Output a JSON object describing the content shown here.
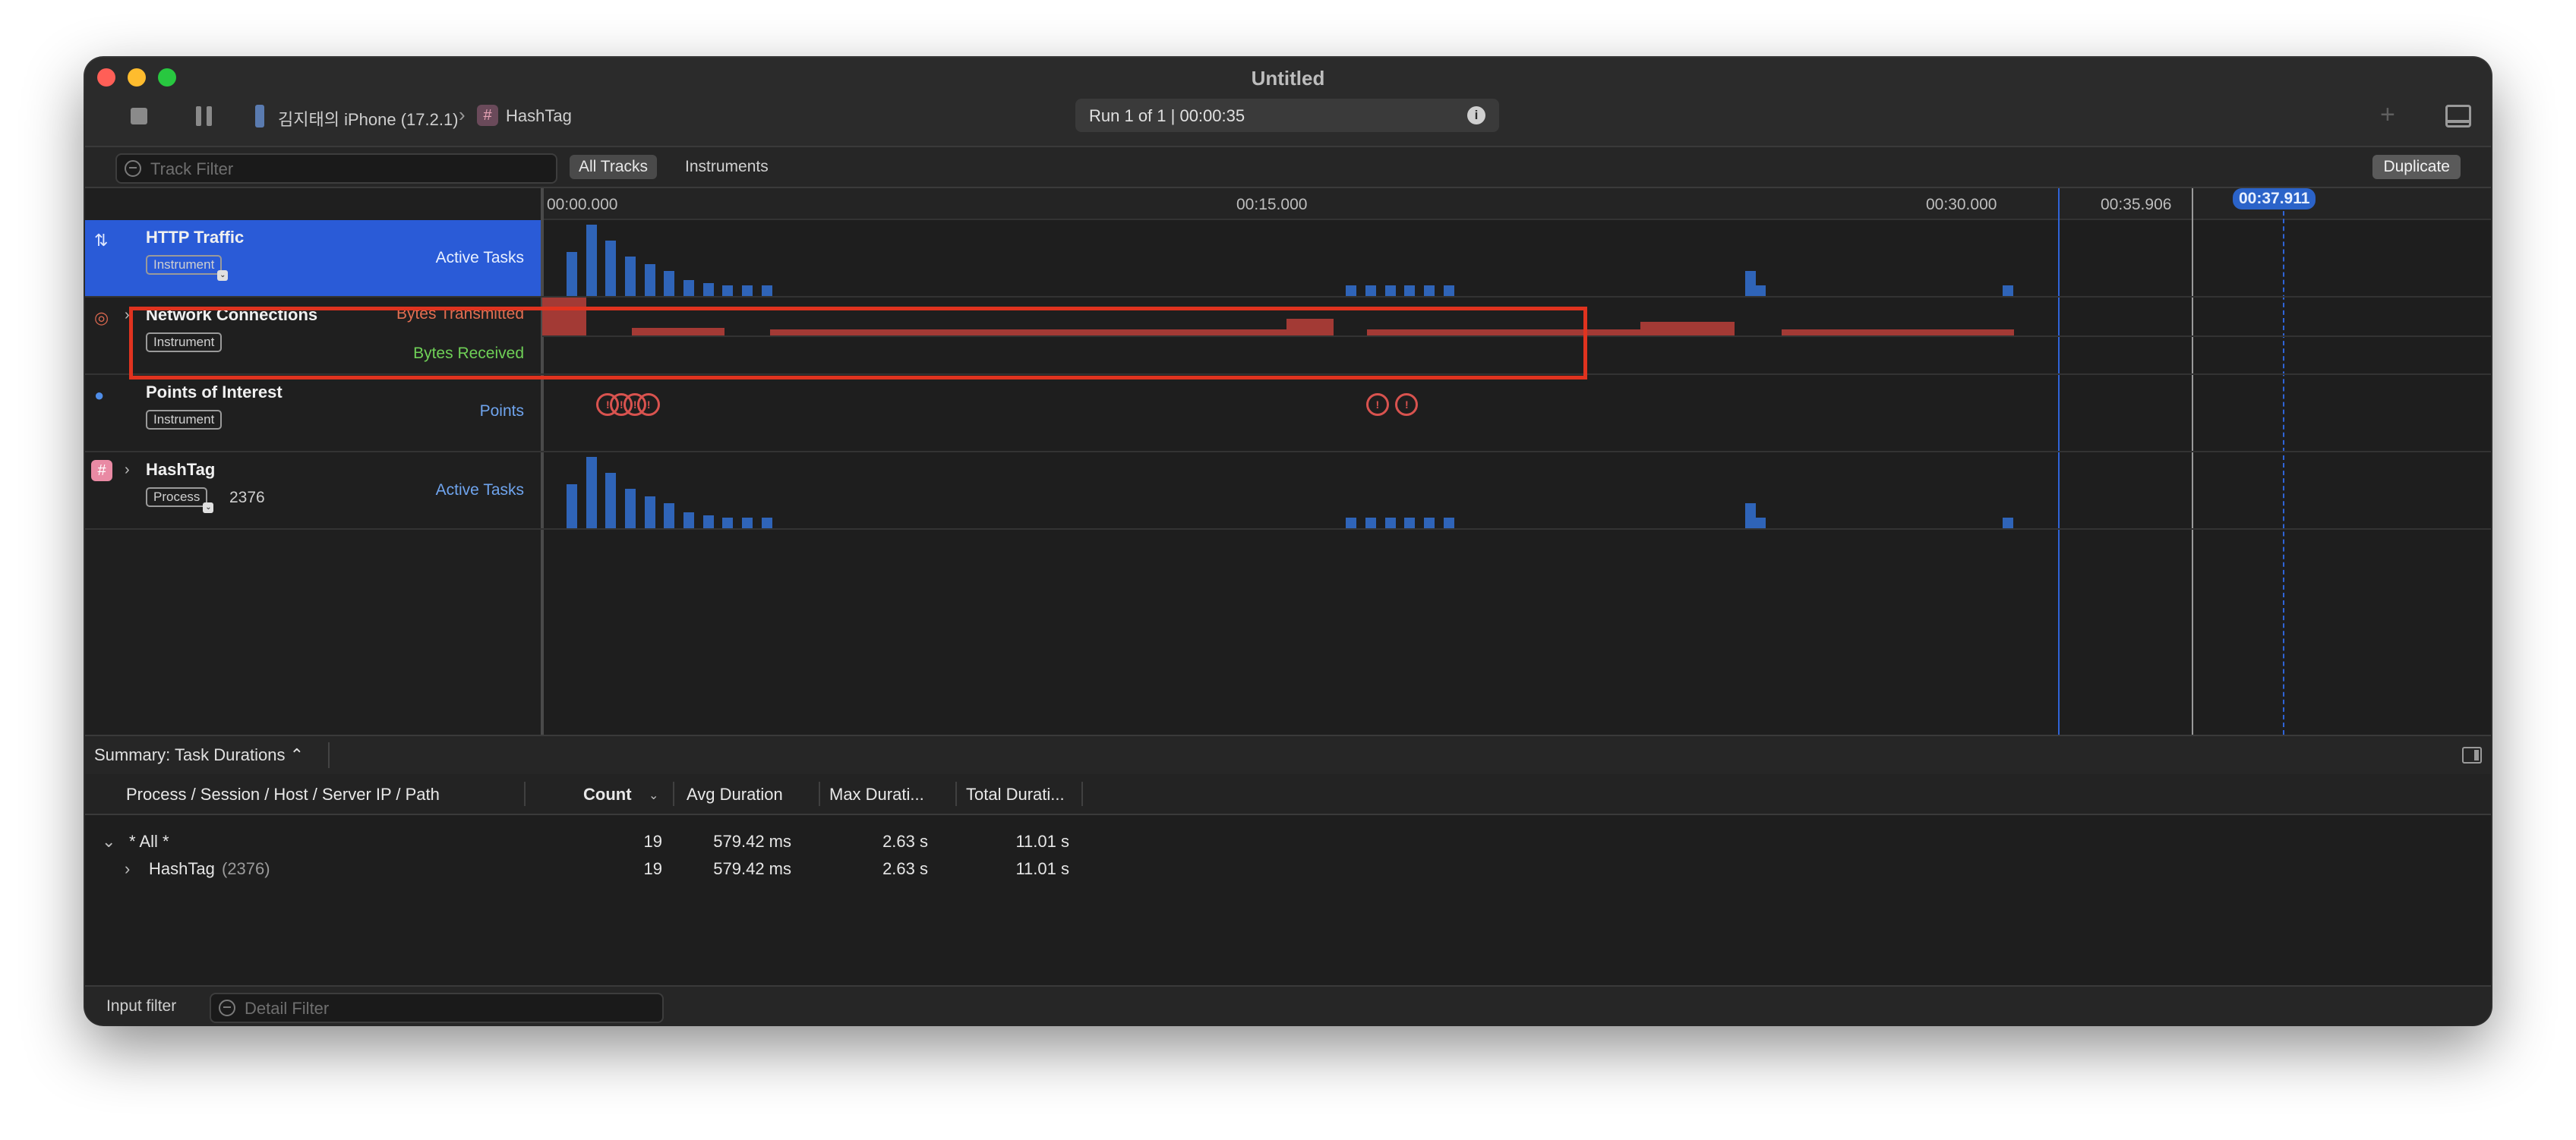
{
  "window": {
    "title": "Untitled"
  },
  "toolbar": {
    "device": "김지태의 iPhone (17.2.1)",
    "app": "HashTag",
    "app_icon_glyph": "#",
    "run_status": "Run 1 of 1  |  00:00:35",
    "info_glyph": "i",
    "plus_glyph": "+"
  },
  "filterbar": {
    "track_filter_placeholder": "Track Filter",
    "all_tracks": "All Tracks",
    "instruments": "Instruments",
    "duplicate": "Duplicate"
  },
  "ruler": {
    "ticks": [
      "00:00.000",
      "00:15.000",
      "00:30.000",
      "00:35.906"
    ],
    "cursor": "00:37.911"
  },
  "tracks": [
    {
      "title": "HTTP Traffic",
      "badge": "Instrument",
      "right": "Active Tasks",
      "icon": "⇅"
    },
    {
      "title": "Network Connections",
      "badge": "Instrument",
      "right_top": "Bytes Transmitted",
      "right_bottom": "Bytes Received",
      "icon": "◎",
      "caret": "›"
    },
    {
      "title": "Points of Interest",
      "badge": "Instrument",
      "right": "Points",
      "icon": "●"
    },
    {
      "title": "HashTag",
      "badge": "Process",
      "pid": "2376",
      "right": "Active Tasks",
      "icon": "#",
      "caret": "›"
    }
  ],
  "summary": {
    "label": "Summary: Task Durations ⌃"
  },
  "table": {
    "headers": [
      "Process / Session / Host / Server IP / Path",
      "Count",
      "Avg Duration",
      "Max Durati...",
      "Total Durati..."
    ],
    "rows": [
      {
        "name": "* All *",
        "caret": "⌄",
        "count": "19",
        "avg": "579.42 ms",
        "max": "2.63 s",
        "total": "11.01 s"
      },
      {
        "name": "HashTag",
        "pid": "(2376)",
        "caret": "›",
        "count": "19",
        "avg": "579.42 ms",
        "max": "2.63 s",
        "total": "11.01 s"
      }
    ]
  },
  "bottom": {
    "input_filter": "Input filter",
    "detail_filter_placeholder": "Detail Filter"
  },
  "colors": {
    "accent": "#2a5bd7",
    "http_bars": "#2f64b8",
    "bytes_tx": "#a33a35",
    "bytes_rx": "#5fbf4a",
    "poi": "#d9534f",
    "highlight": "#e0331f"
  },
  "series": {
    "http": [
      [
        0.0,
        0.62
      ],
      [
        0.01,
        1.0
      ],
      [
        0.02,
        0.78
      ],
      [
        0.03,
        0.55
      ],
      [
        0.04,
        0.45
      ],
      [
        0.05,
        0.35
      ],
      [
        0.06,
        0.22
      ],
      [
        0.07,
        0.18
      ],
      [
        0.08,
        0.15
      ],
      [
        0.09,
        0.15
      ],
      [
        0.1,
        0.15
      ],
      [
        0.4,
        0.15
      ],
      [
        0.41,
        0.15
      ],
      [
        0.42,
        0.15
      ],
      [
        0.43,
        0.15
      ],
      [
        0.44,
        0.15
      ],
      [
        0.45,
        0.15
      ],
      [
        0.605,
        0.35
      ],
      [
        0.61,
        0.15
      ],
      [
        0.737,
        0.15
      ]
    ],
    "poi": [
      0.02,
      0.027,
      0.034,
      0.041,
      0.415,
      0.43
    ]
  }
}
